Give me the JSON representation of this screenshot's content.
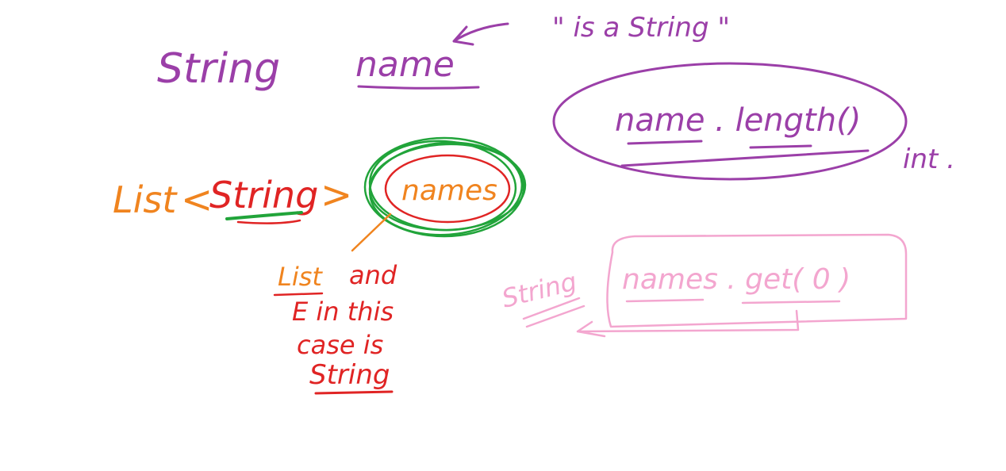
{
  "colors": {
    "purple": "#9b3fa8",
    "orange": "#f0841f",
    "red": "#e02424",
    "green": "#21a43a",
    "pink": "#f3a6cf",
    "background": "#ffffff"
  },
  "top": {
    "type_label": "String",
    "var_label": "name",
    "comment": "\" is a String \"",
    "method_call": "name . length()",
    "return_label": "int ."
  },
  "middle": {
    "list_prefix": "List",
    "generic_open": "<",
    "generic_type": "String",
    "generic_close": ">",
    "var_label": "names"
  },
  "note": {
    "line1_a": "List",
    "line1_b": "and",
    "line2": "E in this",
    "line3": "case is",
    "line4": "String"
  },
  "bottom": {
    "type_label": "String",
    "method_call": "names . get( 0 )"
  }
}
